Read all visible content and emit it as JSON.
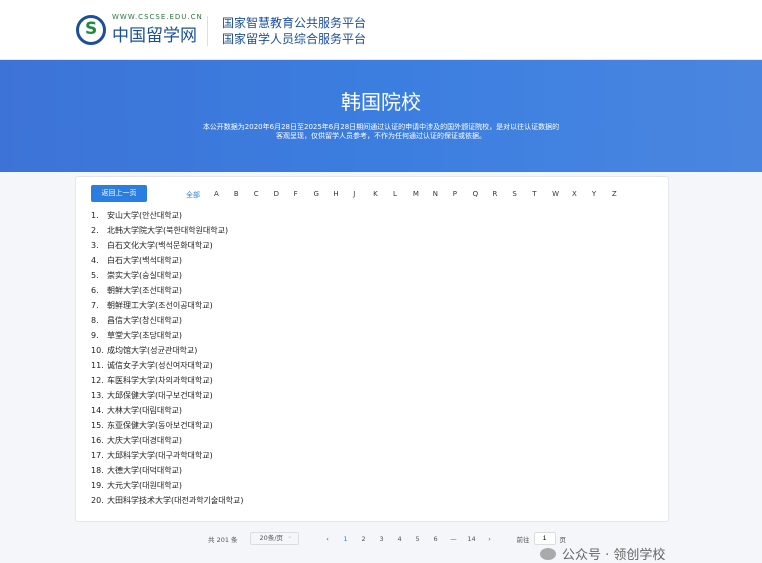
{
  "header": {
    "logo_url": "WWW.CSCSE.EDU.CN",
    "logo_name": "中国留学网",
    "platform_line1": "国家智慧教育公共服务平台",
    "platform_line2": "国家留学人员综合服务平台"
  },
  "banner": {
    "title": "韩国院校",
    "desc": "本公开数据为2020年6月28日至2025年6月28日期间通过认证的申请中涉及的国外颁证院校，是对以往认证数据的客观呈现，仅供留学人员参考，不作为任何通过认证的保证或依据。"
  },
  "toolbar": {
    "back_label": "返回上一页",
    "letters": [
      "全部",
      "A",
      "B",
      "C",
      "D",
      "F",
      "G",
      "H",
      "J",
      "K",
      "L",
      "M",
      "N",
      "P",
      "Q",
      "R",
      "S",
      "T",
      "W",
      "X",
      "Y",
      "Z"
    ]
  },
  "schools": [
    {
      "num": "1.",
      "name": "安山大学(안산대학교)"
    },
    {
      "num": "2.",
      "name": "北韩大学院大学(북한대학원대학교)"
    },
    {
      "num": "3.",
      "name": "白石文化大学(백석문화대학교)"
    },
    {
      "num": "4.",
      "name": "白石大学(백석대학교)"
    },
    {
      "num": "5.",
      "name": "崇实大学(숭실대학교)"
    },
    {
      "num": "6.",
      "name": "朝鲜大学(조선대학교)"
    },
    {
      "num": "7.",
      "name": "朝鲜理工大学(조선이공대학교)"
    },
    {
      "num": "8.",
      "name": "昌信大学(창신대학교)"
    },
    {
      "num": "9.",
      "name": "草堂大学(초당대학교)"
    },
    {
      "num": "10.",
      "name": "成均馆大学(성균관대학교)"
    },
    {
      "num": "11.",
      "name": "诚信女子大学(성신여자대학교)"
    },
    {
      "num": "12.",
      "name": "车医科学大学(차의과학대학교)"
    },
    {
      "num": "13.",
      "name": "大邱保健大学(대구보건대학교)"
    },
    {
      "num": "14.",
      "name": "大林大学(대림대학교)"
    },
    {
      "num": "15.",
      "name": "东亚保健大学(동아보건대학교)"
    },
    {
      "num": "16.",
      "name": "大庆大学(대경대학교)"
    },
    {
      "num": "17.",
      "name": "大邱科学大学(대구과학대학교)"
    },
    {
      "num": "18.",
      "name": "大德大学(대덕대학교)"
    },
    {
      "num": "19.",
      "name": "大元大学(대원대학교)"
    },
    {
      "num": "20.",
      "name": "大田科学技术大学(대전과학기술대학교)"
    }
  ],
  "pagination": {
    "total": "共 201 条",
    "page_size": "20条/页",
    "prev": "‹",
    "pages": [
      "1",
      "2",
      "3",
      "4",
      "5",
      "6",
      "—",
      "14"
    ],
    "next": "›",
    "goto_label": "前往",
    "goto_value": "1",
    "goto_suffix": "页"
  },
  "watermark": {
    "text": "公众号 · 领创学校"
  }
}
